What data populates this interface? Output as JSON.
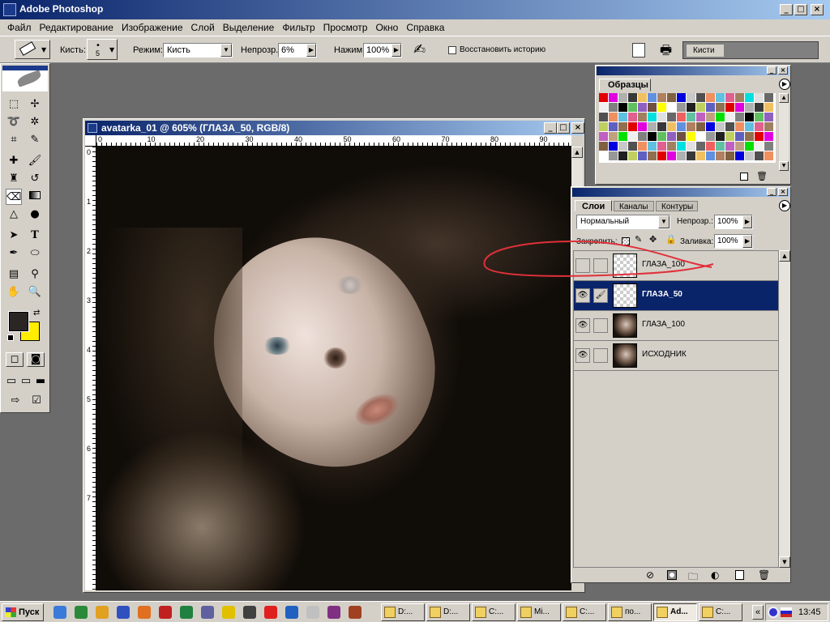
{
  "app": {
    "title": "Adobe Photoshop"
  },
  "menu": [
    "Файл",
    "Редактирование",
    "Изображение",
    "Слой",
    "Выделение",
    "Фильтр",
    "Просмотр",
    "Окно",
    "Справка"
  ],
  "options": {
    "brush_label": "Кисть:",
    "brush_size": "5",
    "mode_label": "Режим:",
    "mode_value": "Кисть",
    "opacity_label": "Непрозр.:",
    "opacity_value": "6%",
    "flow_label": "Нажим:",
    "flow_value": "100%",
    "restore_label": "Восстановить историю",
    "brushes_tab": "Кисти"
  },
  "document": {
    "title": "avatarka_01 @ 605% (ГЛАЗА_50, RGB/8)",
    "ruler_top": [
      "0",
      "10",
      "20",
      "30",
      "40",
      "50",
      "60",
      "70",
      "80",
      "90"
    ],
    "ruler_left": [
      "0",
      "1",
      "2",
      "3",
      "4",
      "5",
      "6",
      "7"
    ]
  },
  "swatches": {
    "tab": "Образцы"
  },
  "layers_panel": {
    "tabs": [
      "Слои",
      "Каналы",
      "Контуры"
    ],
    "blend_mode": "Нормальный",
    "opacity_label": "Непрозр.:",
    "opacity_value": "100%",
    "lock_label": "Закрепить:",
    "fill_label": "Заливка:",
    "fill_value": "100%",
    "layers": [
      {
        "name": "ГЛАЗА_100",
        "visible": false,
        "selected": false,
        "thumb": "transparent"
      },
      {
        "name": "ГЛАЗА_50",
        "visible": true,
        "selected": true,
        "thumb": "transparent"
      },
      {
        "name": "ГЛАЗА_100",
        "visible": true,
        "selected": false,
        "thumb": "photo"
      },
      {
        "name": "ИСХОДНИК",
        "visible": true,
        "selected": false,
        "thumb": "photo"
      }
    ]
  },
  "taskbar": {
    "start": "Пуск",
    "tasks": [
      "D:...",
      "D:...",
      "C:...",
      "Mi...",
      "C:...",
      "по...",
      "Ad...",
      "C:..."
    ],
    "time": "13:45",
    "chevron": "«"
  },
  "colors": {
    "foreground": "#2b2624",
    "background": "#ffee00",
    "selected_layer": "#0a246a",
    "annotation": "#e0303a"
  }
}
